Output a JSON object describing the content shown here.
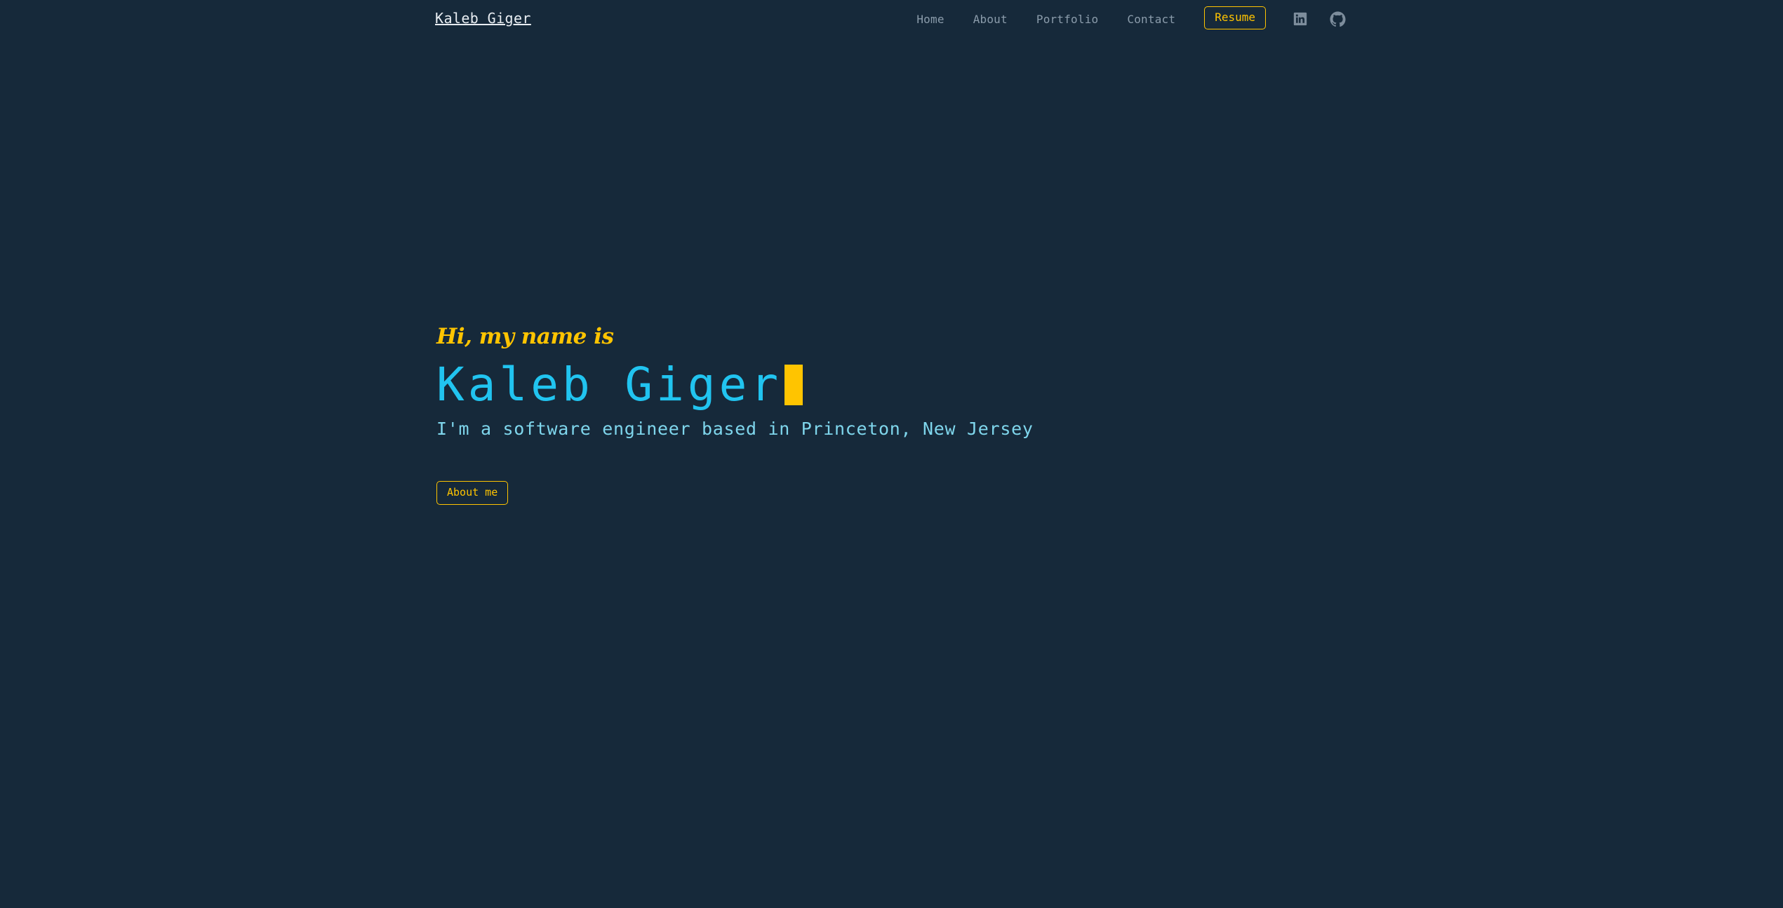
{
  "theme": {
    "background": "#16293a",
    "accent_yellow": "#ffc400",
    "accent_cyan": "#21c4f0",
    "subtitle_cyan": "#7fd6ec",
    "nav_gray": "#8b9cab",
    "brand_white": "#e8edf2"
  },
  "navbar": {
    "brand": "Kaleb Giger",
    "links": [
      {
        "label": "Home"
      },
      {
        "label": "About"
      },
      {
        "label": "Portfolio"
      },
      {
        "label": "Contact"
      }
    ],
    "resume_label": "Resume",
    "socials": [
      {
        "name": "linkedin-icon"
      },
      {
        "name": "github-icon"
      }
    ]
  },
  "hero": {
    "greeting": "Hi, my name is",
    "name": "Kaleb Giger",
    "subtitle": "I'm a software engineer based in Princeton, New Jersey",
    "cta_label": "About me"
  }
}
